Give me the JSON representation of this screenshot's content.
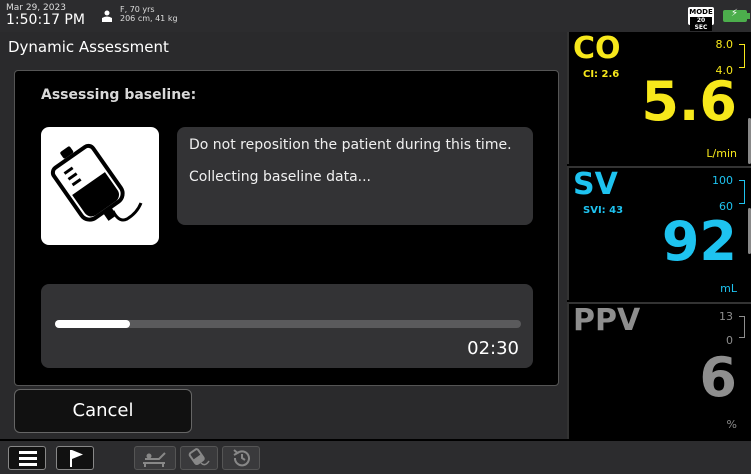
{
  "status_bar": {
    "date": "Mar 29, 2023",
    "time": "1:50:17 PM",
    "patient_line1": "F, 70 yrs",
    "patient_line2": "206 cm, 41 kg",
    "mode_label": "MODE",
    "mode_value": "20 SEC",
    "battery_icon": "battery-charging-icon"
  },
  "assessment": {
    "title": "Dynamic Assessment",
    "heading": "Assessing baseline:",
    "message_1": "Do not reposition the patient during this time.",
    "message_2": "Collecting baseline data...",
    "progress": 0.16,
    "timer": "02:30",
    "cancel_label": "Cancel",
    "icon": "iv-bag-icon"
  },
  "tiles": {
    "co": {
      "name": "CO",
      "sub": "CI: 2.6",
      "range_high": "8.0",
      "range_low": "4.0",
      "value": "5.6",
      "unit": "L/min",
      "color": "#f7e81b"
    },
    "sv": {
      "name": "SV",
      "sub": "SVI: 43",
      "range_high": "100",
      "range_low": "60",
      "value": "92",
      "unit": "mL",
      "color": "#1ec3f0"
    },
    "ppv": {
      "name": "PPV",
      "range_high": "13",
      "range_low": "0",
      "value": "6",
      "unit": "%",
      "color": "#8e8e8e"
    }
  },
  "toolbar": {
    "icons": [
      "menu-icon",
      "flag-icon",
      "bed-icon",
      "iv-bag-icon",
      "history-icon"
    ]
  }
}
